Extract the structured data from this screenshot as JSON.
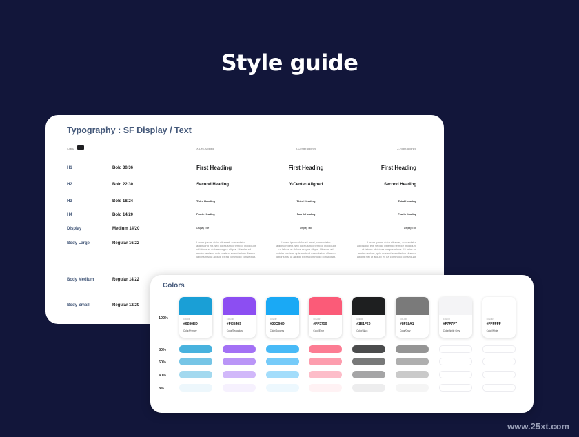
{
  "page_title": "Style guide",
  "typography": {
    "title": "Typography : SF Display / Text",
    "dark_label": "/Dark/",
    "columns": [
      "X-Left-Aligned",
      "Y-Center-Aligned",
      "Z-Right-Aligned"
    ],
    "rows": [
      {
        "label": "H1",
        "spec": "Bold 30/36",
        "sample_left": "First Heading",
        "sample_center": "First Heading",
        "sample_right": "First Heading"
      },
      {
        "label": "H2",
        "spec": "Bold 22/30",
        "sample_left": "Second Heading",
        "sample_center": "Y-Center-Aligned",
        "sample_right": "Second Heading"
      },
      {
        "label": "H3",
        "spec": "Bold 18/24",
        "sample_left": "Third Heading",
        "sample_center": "Third Heading",
        "sample_right": "Third Heading"
      },
      {
        "label": "H4",
        "spec": "Bold 14/20",
        "sample_left": "Fourth Heading",
        "sample_center": "Fourth Heading",
        "sample_right": "Fourth Heading"
      },
      {
        "label": "Display",
        "spec": "Medium 14/20",
        "sample_left": "Display Title",
        "sample_center": "Display Title",
        "sample_right": "Display Title"
      },
      {
        "label": "Body Large",
        "spec": "Regular 16/22"
      },
      {
        "label": "Body Medium",
        "spec": "Regular 14/22"
      },
      {
        "label": "Body Small",
        "spec": "Regular 12/20"
      }
    ],
    "body_text": "Lorem ipsum dolor sit amet, consectetur adipiscing elit, sed do eiusmod tempor incididunt ut labore et dolore magna aliqua. Ut enim ad minim veniam, quis nostrud exercitation ullamco laboris nisi ut aliquip ex ea commodo consequat."
  },
  "colors": {
    "title": "Colors",
    "caption": "COLOR",
    "percent_labels": [
      "100%",
      "80%",
      "60%",
      "40%",
      "8%"
    ],
    "shade_opacities": [
      0.8,
      0.6,
      0.4,
      0.08
    ],
    "swatches": [
      {
        "hex_label": "#6286ED",
        "name": "Color/Primary",
        "color": "#1a9fd6"
      },
      {
        "hex_label": "#FCE489",
        "name": "Color/Secondary",
        "color": "#8c4ef2"
      },
      {
        "hex_label": "#33C66D",
        "name": "Color/Success",
        "color": "#1aa9f5"
      },
      {
        "hex_label": "#FF3750",
        "name": "Color/Error",
        "color": "#fb5b78"
      },
      {
        "hex_label": "#1E1F20",
        "name": "Color/Black",
        "color": "#1e1f20"
      },
      {
        "hex_label": "#8F92A1",
        "name": "Color/Gray",
        "color": "#7a7a7a"
      },
      {
        "hex_label": "#F7F7F7",
        "name": "Color/White Grey",
        "color": "#f4f4f6"
      },
      {
        "hex_label": "#FFFFFF",
        "name": "Color/White",
        "color": "#ffffff"
      }
    ]
  },
  "watermark": "www.25xt.com"
}
